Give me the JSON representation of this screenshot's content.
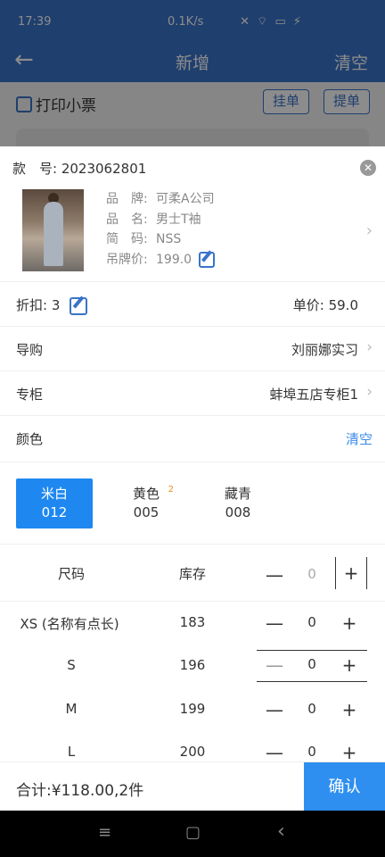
{
  "status_bar": {
    "time": "17:39",
    "speed": "0.1K/s",
    "icons": "✕ ⌔ ▭ ⚡"
  },
  "nav": {
    "back_icon": "arrow-left-icon",
    "title": "新增",
    "clear": "清空"
  },
  "background_page": {
    "print_label": "打印小票",
    "hold_label": "挂单",
    "fetch_label": "提单"
  },
  "product": {
    "code_label": "款　号:",
    "code_value": "2023062801",
    "brand_label": "品　牌:",
    "brand_value": "可柔A公司",
    "name_label": "品　名:",
    "name_value": "男士T袖",
    "short_label": "简　码:",
    "short_value": "NSS",
    "tag_label": "吊牌价:",
    "tag_value": "199.0"
  },
  "discount": {
    "label": "折扣:",
    "value": "3"
  },
  "unit_price": {
    "label": "单价:",
    "value": "59.0"
  },
  "guide": {
    "label": "导购",
    "value": "刘丽娜实习"
  },
  "counter": {
    "label": "专柜",
    "value": "蚌埠五店专柜1"
  },
  "color_section": {
    "label": "颜色",
    "clear": "清空"
  },
  "colors": [
    {
      "name": "米白",
      "code": "012",
      "selected": true,
      "badge": ""
    },
    {
      "name": "黄色",
      "code": "005",
      "selected": false,
      "badge": "2"
    },
    {
      "name": "藏青",
      "code": "008",
      "selected": false,
      "badge": ""
    }
  ],
  "size_table": {
    "headers": {
      "size": "尺码",
      "stock": "库存",
      "qty": "0"
    },
    "rows": [
      {
        "size": "XS (名称有点长)",
        "stock": "183",
        "qty": "0"
      },
      {
        "size": "S",
        "stock": "196",
        "qty": "0"
      },
      {
        "size": "M",
        "stock": "199",
        "qty": "0"
      },
      {
        "size": "L",
        "stock": "200",
        "qty": "0"
      }
    ]
  },
  "stepper_symbols": {
    "minus": "—",
    "plus": "+"
  },
  "footer": {
    "total": "合计:¥118.00,2件",
    "confirm": "确认"
  },
  "system_nav": {
    "menu": "≡",
    "home": "▢",
    "back": "‹"
  }
}
